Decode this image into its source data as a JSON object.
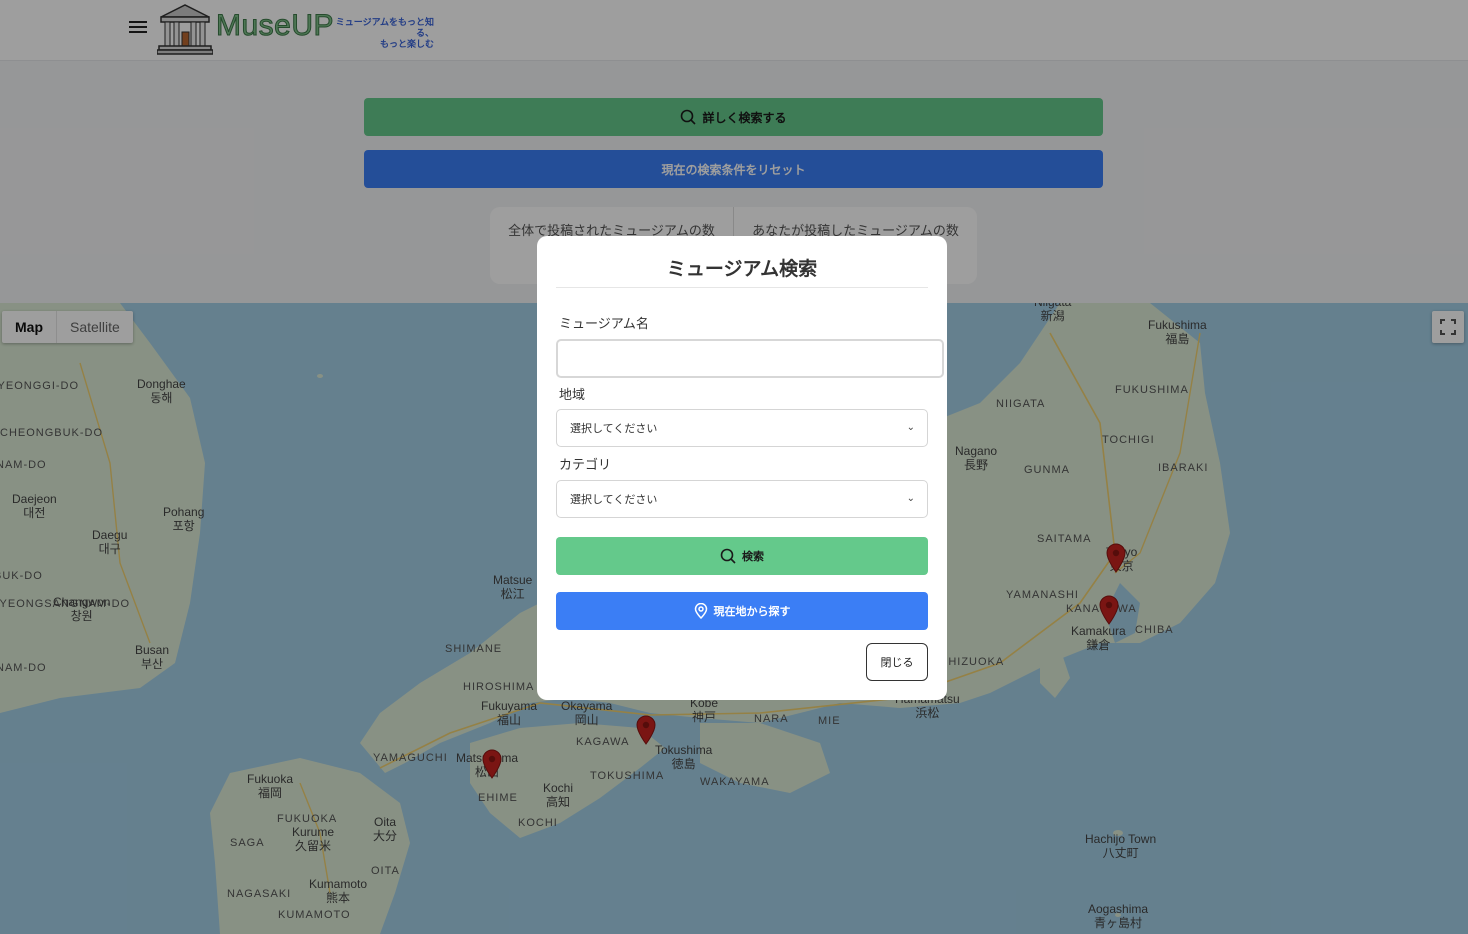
{
  "header": {
    "logo_text": "MuseUP",
    "tagline_line1": "ミュージアムをもっと知る、",
    "tagline_line2": "もっと楽しむ"
  },
  "actions": {
    "detail_search_label": "詳しく検索する",
    "reset_label": "現在の検索条件をリセット"
  },
  "counts": {
    "total_label": "全体で投稿されたミュージアムの数",
    "mine_label": "あなたが投稿したミュージアムの数"
  },
  "map": {
    "map_type": "Map",
    "satellite_type": "Satellite",
    "labels": [
      "Niigata\n新潟",
      "Fukushima\n福島",
      "FUKUSHIMA",
      "NIIGATA",
      "TOCHIGI",
      "Nagano\n長野",
      "GUNMA",
      "IBARAKI",
      "SAITAMA",
      "Tokyo\n東京",
      "YAMANASHI",
      "KANAGAWA",
      "Kamakura\n鎌倉",
      "CHIBA",
      "SHIZUOKA",
      "Hamamatsu\n浜松",
      "Hachijo Town\n八丈町",
      "Aogashima\n青ヶ島村",
      "GYEONGGI-DO",
      "Donghae\n동해",
      "CHEONGBUK-DO",
      "NAM-DO",
      "Daejeon\n대전",
      "Daegu\n대구",
      "Pohang\n포항",
      "BUK-DO",
      "GYEONGSANGNAM-DO",
      "Changwon\n창원",
      "Busan\n부산",
      "NAM-DO",
      "Matsue\n松江",
      "SHIMANE",
      "HIROSHIMA",
      "Fukuyama\n福山",
      "Okayama\n岡山",
      "Kobe\n神戸",
      "NARA",
      "MIE",
      "KAGAWA",
      "Tokushima\n徳島",
      "TOKUSHIMA",
      "WAKAYAMA",
      "YAMAGUCHI",
      "Matsuyama\n松山",
      "EHIME",
      "Kochi\n高知",
      "KOCHI",
      "Fukuoka\n福岡",
      "FUKUOKA",
      "Kurume\n久留米",
      "Oita\n大分",
      "OITA",
      "SAGA",
      "NAGASAKI",
      "Kumamoto\n熊本",
      "KUMAMOTO"
    ],
    "marker_color": "#c5221f"
  },
  "modal": {
    "title": "ミュージアム検索",
    "name_label": "ミュージアム名",
    "name_value": "",
    "region_label": "地域",
    "region_selected": "選択してください",
    "category_label": "カテゴリ",
    "category_selected": "選択してください",
    "search_button": "検索",
    "location_button": "現在地から探す",
    "close_button": "閉じる"
  },
  "colors": {
    "green": "#64c98b",
    "blue": "#3b7ef5",
    "water": "#a3cfe6",
    "land": "#dcebd6"
  }
}
